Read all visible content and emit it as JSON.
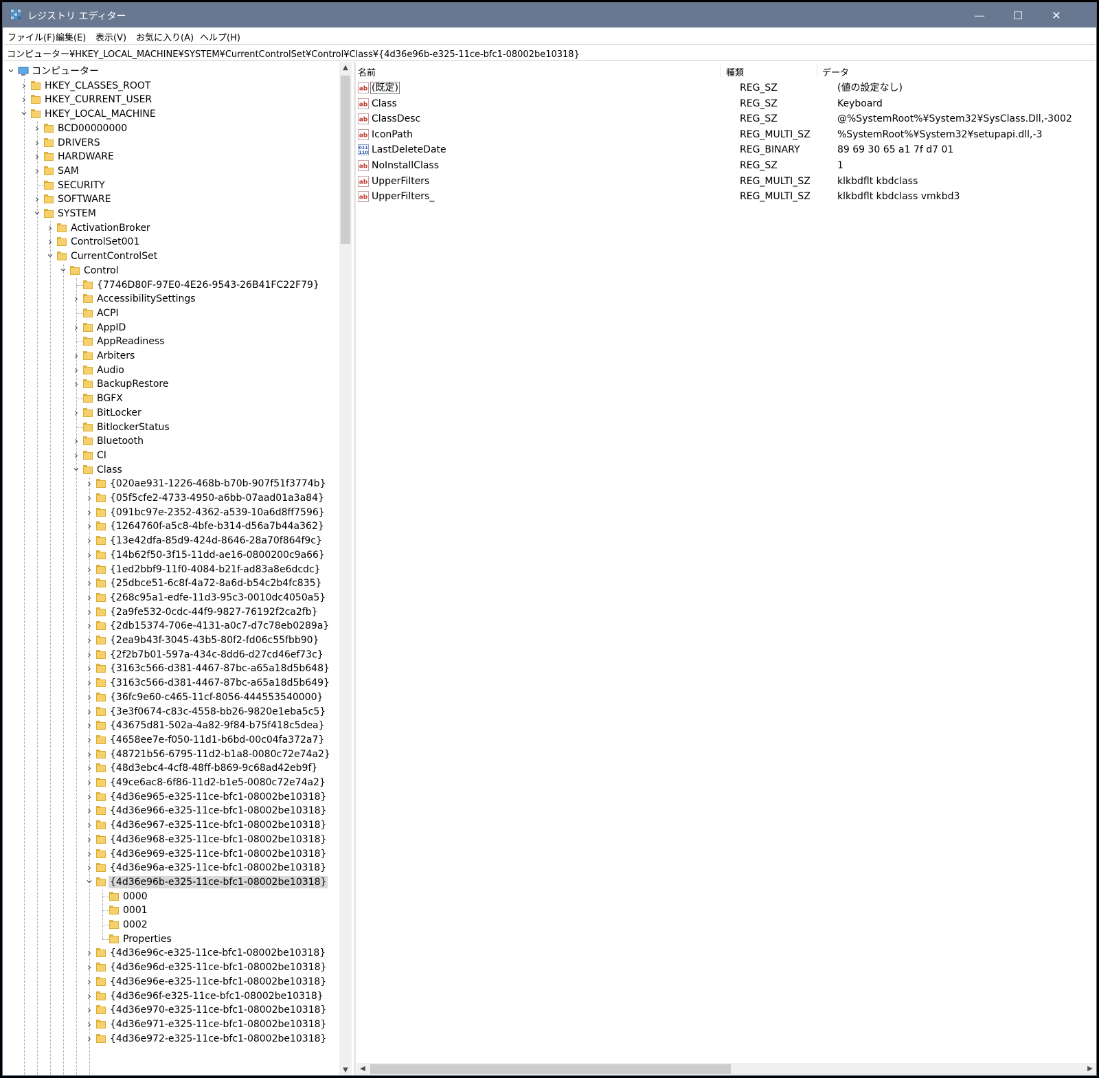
{
  "window": {
    "title": "レジストリ エディター",
    "controls": {
      "minimize": "—",
      "maximize": "☐",
      "close": "✕"
    }
  },
  "menu": [
    {
      "label": "ファイル(F)"
    },
    {
      "label": "編集(E)"
    },
    {
      "label": "表示(V)"
    },
    {
      "label": "お気に入り(A)"
    },
    {
      "label": "ヘルプ(H)"
    }
  ],
  "address": "コンピューター¥HKEY_LOCAL_MACHINE¥SYSTEM¥CurrentControlSet¥Control¥Class¥{4d36e96b-e325-11ce-bfc1-08002be10318}",
  "tree": [
    {
      "label": "コンピューター",
      "depth": 0,
      "toggle": "open",
      "icon": "computer"
    },
    {
      "label": "HKEY_CLASSES_ROOT",
      "depth": 1,
      "toggle": "closed"
    },
    {
      "label": "HKEY_CURRENT_USER",
      "depth": 1,
      "toggle": "closed"
    },
    {
      "label": "HKEY_LOCAL_MACHINE",
      "depth": 1,
      "toggle": "open"
    },
    {
      "label": "BCD00000000",
      "depth": 2,
      "toggle": "closed"
    },
    {
      "label": "DRIVERS",
      "depth": 2,
      "toggle": "closed"
    },
    {
      "label": "HARDWARE",
      "depth": 2,
      "toggle": "closed"
    },
    {
      "label": "SAM",
      "depth": 2,
      "toggle": "closed"
    },
    {
      "label": "SECURITY",
      "depth": 2,
      "toggle": "none"
    },
    {
      "label": "SOFTWARE",
      "depth": 2,
      "toggle": "closed"
    },
    {
      "label": "SYSTEM",
      "depth": 2,
      "toggle": "open"
    },
    {
      "label": "ActivationBroker",
      "depth": 3,
      "toggle": "closed"
    },
    {
      "label": "ControlSet001",
      "depth": 3,
      "toggle": "closed"
    },
    {
      "label": "CurrentControlSet",
      "depth": 3,
      "toggle": "open"
    },
    {
      "label": "Control",
      "depth": 4,
      "toggle": "open"
    },
    {
      "label": "{7746D80F-97E0-4E26-9543-26B41FC22F79}",
      "depth": 5,
      "toggle": "none"
    },
    {
      "label": "AccessibilitySettings",
      "depth": 5,
      "toggle": "closed"
    },
    {
      "label": "ACPI",
      "depth": 5,
      "toggle": "none"
    },
    {
      "label": "AppID",
      "depth": 5,
      "toggle": "closed"
    },
    {
      "label": "AppReadiness",
      "depth": 5,
      "toggle": "none"
    },
    {
      "label": "Arbiters",
      "depth": 5,
      "toggle": "closed"
    },
    {
      "label": "Audio",
      "depth": 5,
      "toggle": "closed"
    },
    {
      "label": "BackupRestore",
      "depth": 5,
      "toggle": "closed"
    },
    {
      "label": "BGFX",
      "depth": 5,
      "toggle": "none"
    },
    {
      "label": "BitLocker",
      "depth": 5,
      "toggle": "closed"
    },
    {
      "label": "BitlockerStatus",
      "depth": 5,
      "toggle": "none"
    },
    {
      "label": "Bluetooth",
      "depth": 5,
      "toggle": "closed"
    },
    {
      "label": "CI",
      "depth": 5,
      "toggle": "closed"
    },
    {
      "label": "Class",
      "depth": 5,
      "toggle": "open"
    },
    {
      "label": "{020ae931-1226-468b-b70b-907f51f3774b}",
      "depth": 6,
      "toggle": "closed"
    },
    {
      "label": "{05f5cfe2-4733-4950-a6bb-07aad01a3a84}",
      "depth": 6,
      "toggle": "closed"
    },
    {
      "label": "{091bc97e-2352-4362-a539-10a6d8ff7596}",
      "depth": 6,
      "toggle": "closed"
    },
    {
      "label": "{1264760f-a5c8-4bfe-b314-d56a7b44a362}",
      "depth": 6,
      "toggle": "closed"
    },
    {
      "label": "{13e42dfa-85d9-424d-8646-28a70f864f9c}",
      "depth": 6,
      "toggle": "closed"
    },
    {
      "label": "{14b62f50-3f15-11dd-ae16-0800200c9a66}",
      "depth": 6,
      "toggle": "closed"
    },
    {
      "label": "{1ed2bbf9-11f0-4084-b21f-ad83a8e6dcdc}",
      "depth": 6,
      "toggle": "closed"
    },
    {
      "label": "{25dbce51-6c8f-4a72-8a6d-b54c2b4fc835}",
      "depth": 6,
      "toggle": "closed"
    },
    {
      "label": "{268c95a1-edfe-11d3-95c3-0010dc4050a5}",
      "depth": 6,
      "toggle": "closed"
    },
    {
      "label": "{2a9fe532-0cdc-44f9-9827-76192f2ca2fb}",
      "depth": 6,
      "toggle": "closed"
    },
    {
      "label": "{2db15374-706e-4131-a0c7-d7c78eb0289a}",
      "depth": 6,
      "toggle": "closed"
    },
    {
      "label": "{2ea9b43f-3045-43b5-80f2-fd06c55fbb90}",
      "depth": 6,
      "toggle": "closed"
    },
    {
      "label": "{2f2b7b01-597a-434c-8dd6-d27cd46ef73c}",
      "depth": 6,
      "toggle": "closed"
    },
    {
      "label": "{3163c566-d381-4467-87bc-a65a18d5b648}",
      "depth": 6,
      "toggle": "closed"
    },
    {
      "label": "{3163c566-d381-4467-87bc-a65a18d5b649}",
      "depth": 6,
      "toggle": "closed"
    },
    {
      "label": "{36fc9e60-c465-11cf-8056-444553540000}",
      "depth": 6,
      "toggle": "closed"
    },
    {
      "label": "{3e3f0674-c83c-4558-bb26-9820e1eba5c5}",
      "depth": 6,
      "toggle": "closed"
    },
    {
      "label": "{43675d81-502a-4a82-9f84-b75f418c5dea}",
      "depth": 6,
      "toggle": "closed"
    },
    {
      "label": "{4658ee7e-f050-11d1-b6bd-00c04fa372a7}",
      "depth": 6,
      "toggle": "closed"
    },
    {
      "label": "{48721b56-6795-11d2-b1a8-0080c72e74a2}",
      "depth": 6,
      "toggle": "closed"
    },
    {
      "label": "{48d3ebc4-4cf8-48ff-b869-9c68ad42eb9f}",
      "depth": 6,
      "toggle": "closed"
    },
    {
      "label": "{49ce6ac8-6f86-11d2-b1e5-0080c72e74a2}",
      "depth": 6,
      "toggle": "closed"
    },
    {
      "label": "{4d36e965-e325-11ce-bfc1-08002be10318}",
      "depth": 6,
      "toggle": "closed"
    },
    {
      "label": "{4d36e966-e325-11ce-bfc1-08002be10318}",
      "depth": 6,
      "toggle": "closed"
    },
    {
      "label": "{4d36e967-e325-11ce-bfc1-08002be10318}",
      "depth": 6,
      "toggle": "closed"
    },
    {
      "label": "{4d36e968-e325-11ce-bfc1-08002be10318}",
      "depth": 6,
      "toggle": "closed"
    },
    {
      "label": "{4d36e969-e325-11ce-bfc1-08002be10318}",
      "depth": 6,
      "toggle": "closed"
    },
    {
      "label": "{4d36e96a-e325-11ce-bfc1-08002be10318}",
      "depth": 6,
      "toggle": "closed"
    },
    {
      "label": "{4d36e96b-e325-11ce-bfc1-08002be10318}",
      "depth": 6,
      "toggle": "open",
      "selected": true
    },
    {
      "label": "0000",
      "depth": 7,
      "toggle": "none"
    },
    {
      "label": "0001",
      "depth": 7,
      "toggle": "none"
    },
    {
      "label": "0002",
      "depth": 7,
      "toggle": "none"
    },
    {
      "label": "Properties",
      "depth": 7,
      "toggle": "none"
    },
    {
      "label": "{4d36e96c-e325-11ce-bfc1-08002be10318}",
      "depth": 6,
      "toggle": "closed"
    },
    {
      "label": "{4d36e96d-e325-11ce-bfc1-08002be10318}",
      "depth": 6,
      "toggle": "closed"
    },
    {
      "label": "{4d36e96e-e325-11ce-bfc1-08002be10318}",
      "depth": 6,
      "toggle": "closed"
    },
    {
      "label": "{4d36e96f-e325-11ce-bfc1-08002be10318}",
      "depth": 6,
      "toggle": "closed"
    },
    {
      "label": "{4d36e970-e325-11ce-bfc1-08002be10318}",
      "depth": 6,
      "toggle": "closed"
    },
    {
      "label": "{4d36e971-e325-11ce-bfc1-08002be10318}",
      "depth": 6,
      "toggle": "closed"
    },
    {
      "label": "{4d36e972-e325-11ce-bfc1-08002be10318}",
      "depth": 6,
      "toggle": "closed"
    }
  ],
  "list": {
    "columns": {
      "name": "名前",
      "type": "種類",
      "data": "データ"
    },
    "rows": [
      {
        "name": "(既定)",
        "type": "REG_SZ",
        "data": "(値の設定なし)",
        "icon": "string-value-icon",
        "focused": true
      },
      {
        "name": "Class",
        "type": "REG_SZ",
        "data": "Keyboard",
        "icon": "string-value-icon"
      },
      {
        "name": "ClassDesc",
        "type": "REG_SZ",
        "data": "@%SystemRoot%¥System32¥SysClass.Dll,-3002",
        "icon": "string-value-icon"
      },
      {
        "name": "IconPath",
        "type": "REG_MULTI_SZ",
        "data": "%SystemRoot%¥System32¥setupapi.dll,-3",
        "icon": "string-value-icon"
      },
      {
        "name": "LastDeleteDate",
        "type": "REG_BINARY",
        "data": "89 69 30 65 a1 7f d7 01",
        "icon": "binary-value-icon"
      },
      {
        "name": "NoInstallClass",
        "type": "REG_SZ",
        "data": "1",
        "icon": "string-value-icon"
      },
      {
        "name": "UpperFilters",
        "type": "REG_MULTI_SZ",
        "data": "klkbdflt kbdclass",
        "icon": "string-value-icon"
      },
      {
        "name": "UpperFilters_",
        "type": "REG_MULTI_SZ",
        "data": "klkbdflt kbdclass vmkbd3",
        "icon": "string-value-icon"
      }
    ]
  }
}
